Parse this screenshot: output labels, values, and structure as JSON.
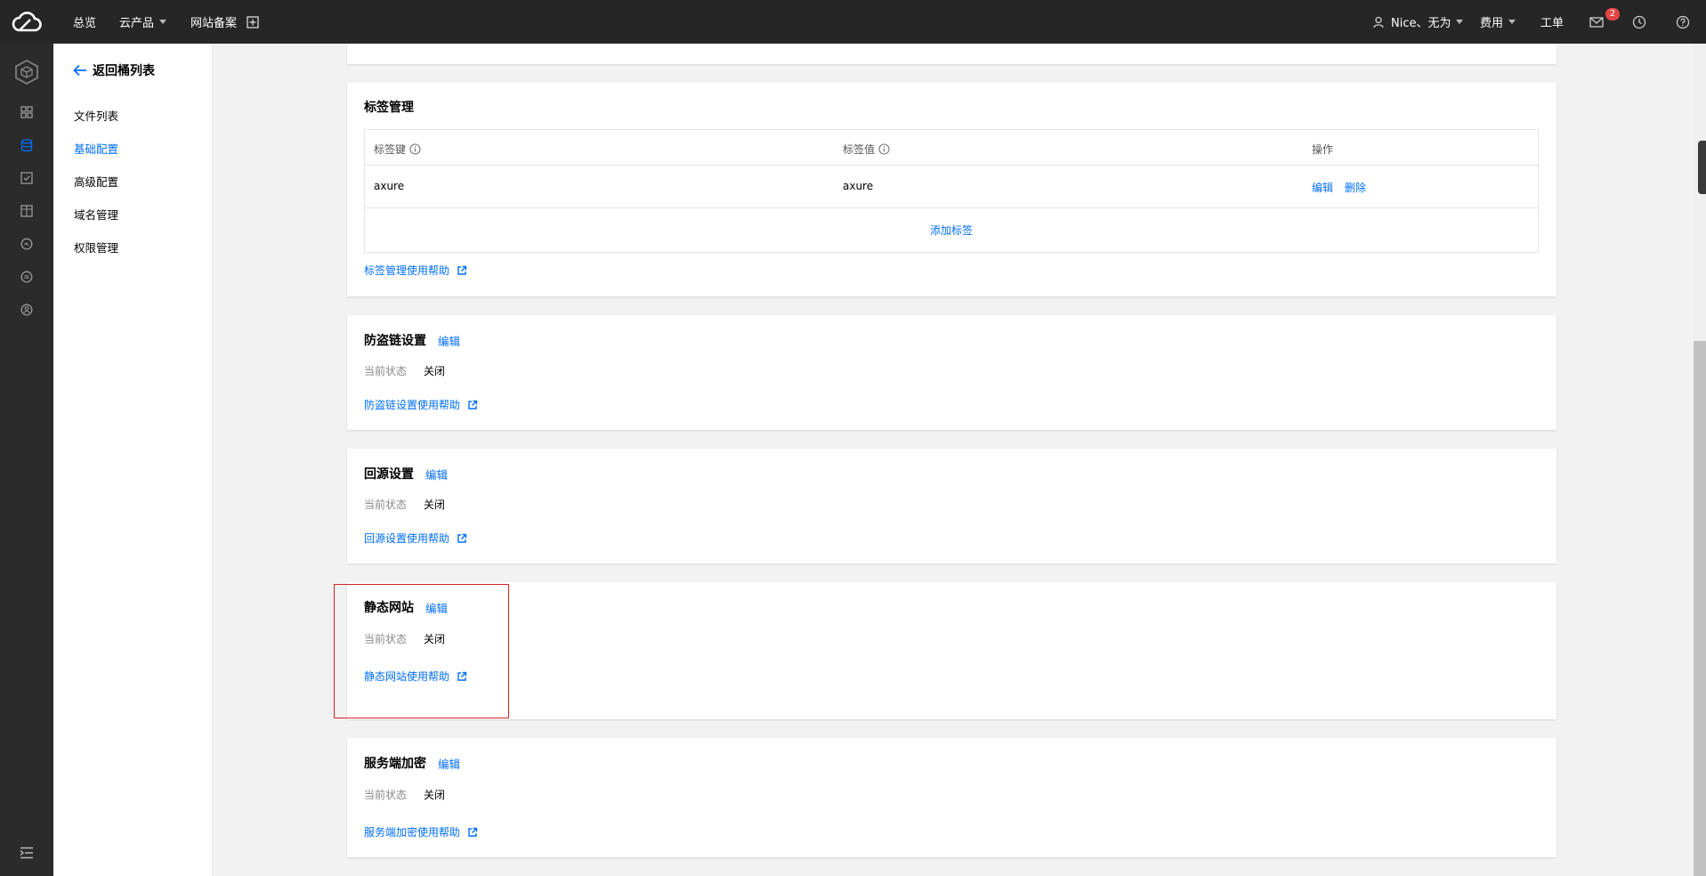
{
  "topbar": {
    "logo_icon": "cloud-logo-icon",
    "overview": "总览",
    "products": "云产品",
    "beian": "网站备案",
    "user": "Nice、无为",
    "billing": "费用",
    "ticket": "工单",
    "mail_count": "2"
  },
  "iconbar": {
    "items": [
      "cube-icon",
      "grid-icon",
      "database-icon",
      "checkbox-icon",
      "image-check-icon",
      "search-chart-icon",
      "equal-circle-icon",
      "user-circle-icon"
    ],
    "collapse": "collapse-menu-icon"
  },
  "sidenav": {
    "back": "返回桶列表",
    "items": [
      {
        "label": "文件列表"
      },
      {
        "label": "基础配置",
        "active": true
      },
      {
        "label": "高级配置"
      },
      {
        "label": "域名管理"
      },
      {
        "label": "权限管理"
      }
    ]
  },
  "tags": {
    "title": "标签管理",
    "col_key": "标签键",
    "col_value": "标签值",
    "col_action": "操作",
    "rows": [
      {
        "key": "axure",
        "value": "axure",
        "edit": "编辑",
        "delete": "删除"
      }
    ],
    "add": "添加标签",
    "help": "标签管理使用帮助"
  },
  "hotlink": {
    "title": "防盗链设置",
    "edit": "编辑",
    "status_label": "当前状态",
    "status": "关闭",
    "help": "防盗链设置使用帮助"
  },
  "origin": {
    "title": "回源设置",
    "edit": "编辑",
    "status_label": "当前状态",
    "status": "关闭",
    "help": "回源设置使用帮助"
  },
  "static": {
    "title": "静态网站",
    "edit": "编辑",
    "status_label": "当前状态",
    "status": "关闭",
    "help": "静态网站使用帮助"
  },
  "encrypt": {
    "title": "服务端加密",
    "edit": "编辑",
    "status_label": "当前状态",
    "status": "关闭",
    "help": "服务端加密使用帮助"
  },
  "colors": {
    "accent": "#006eff",
    "highlight": "#e02020",
    "topbar": "#262626"
  }
}
